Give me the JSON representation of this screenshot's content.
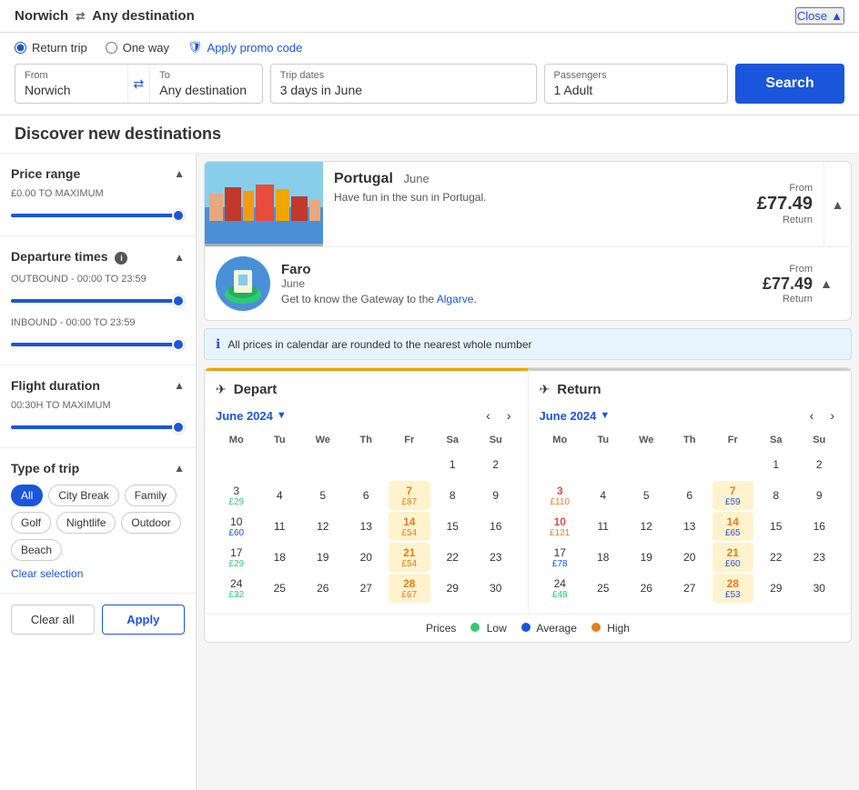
{
  "header": {
    "from": "Norwich",
    "to": "Any destination",
    "close_label": "Close"
  },
  "search_bar": {
    "return_trip_label": "Return trip",
    "one_way_label": "One way",
    "promo_label": "Apply promo code",
    "from_label": "From",
    "from_value": "Norwich",
    "to_label": "To",
    "to_value": "Any destination",
    "trip_dates_label": "Trip dates",
    "trip_dates_value": "3 days in June",
    "passengers_label": "Passengers",
    "passengers_value": "1 Adult",
    "search_button": "Search"
  },
  "discover_banner": "Discover new destinations",
  "filters": {
    "price_range": {
      "title": "Price range",
      "subtitle": "£0.00 TO MAXIMUM"
    },
    "departure_times": {
      "title": "Departure times",
      "outbound_label": "OUTBOUND - 00:00 TO 23:59",
      "inbound_label": "INBOUND - 00:00 TO 23:59"
    },
    "flight_duration": {
      "title": "Flight duration",
      "subtitle": "00:30H TO MAXIMUM"
    },
    "type_of_trip": {
      "title": "Type of trip",
      "tags": [
        "All",
        "City Break",
        "Family",
        "Golf",
        "Nightlife",
        "Outdoor",
        "Beach"
      ],
      "active_tag": "All",
      "clear_selection": "Clear selection"
    },
    "clear_label": "Clear all",
    "apply_label": "Apply"
  },
  "portugal_card": {
    "name": "Portugal",
    "month": "June",
    "desc": "Have fun in the sun in Portugal.",
    "from_label": "From",
    "price": "£77.49",
    "return_label": "Return"
  },
  "faro_card": {
    "name": "Faro",
    "month": "June",
    "desc": "Get to know the Gateway to the Algarve.",
    "from_label": "From",
    "price": "£77.49",
    "return_label": "Return",
    "algarve_word": "Algarve"
  },
  "notice": {
    "text": "All prices in calendar are rounded to the nearest whole number"
  },
  "depart_calendar": {
    "title": "Depart",
    "month": "June 2024",
    "day_headers": [
      "Mo",
      "Tu",
      "We",
      "Th",
      "Fr",
      "Sa",
      "Su"
    ],
    "weeks": [
      [
        null,
        null,
        null,
        null,
        null,
        {
          "num": "1",
          "price": null,
          "type": null
        },
        {
          "num": "2",
          "price": null,
          "type": null
        }
      ],
      [
        {
          "num": "3",
          "price": "£29",
          "type": "low"
        },
        {
          "num": "4",
          "price": null,
          "type": null
        },
        {
          "num": "5",
          "price": null,
          "type": null
        },
        {
          "num": "6",
          "price": null,
          "type": null
        },
        {
          "num": "7",
          "price": "£87",
          "type": "high",
          "highlight": true
        },
        {
          "num": "8",
          "price": null,
          "type": null
        },
        {
          "num": "9",
          "price": null,
          "type": null
        }
      ],
      [
        {
          "num": "10",
          "price": "£60",
          "type": "avg"
        },
        {
          "num": "11",
          "price": null,
          "type": null
        },
        {
          "num": "12",
          "price": null,
          "type": null
        },
        {
          "num": "13",
          "price": null,
          "type": null
        },
        {
          "num": "14",
          "price": "£54",
          "type": "high",
          "highlight": true
        },
        {
          "num": "15",
          "price": null,
          "type": null
        },
        {
          "num": "16",
          "price": null,
          "type": null
        }
      ],
      [
        {
          "num": "17",
          "price": "£29",
          "type": "low"
        },
        {
          "num": "18",
          "price": null,
          "type": null
        },
        {
          "num": "19",
          "price": null,
          "type": null
        },
        {
          "num": "20",
          "price": null,
          "type": null
        },
        {
          "num": "21",
          "price": "£54",
          "type": "high",
          "highlight": true
        },
        {
          "num": "22",
          "price": null,
          "type": null
        },
        {
          "num": "23",
          "price": null,
          "type": null
        }
      ],
      [
        {
          "num": "24",
          "price": "£32",
          "type": "low"
        },
        {
          "num": "25",
          "price": null,
          "type": null
        },
        {
          "num": "26",
          "price": null,
          "type": null
        },
        {
          "num": "27",
          "price": null,
          "type": null
        },
        {
          "num": "28",
          "price": "£67",
          "type": "high",
          "highlight": true
        },
        {
          "num": "29",
          "price": null,
          "type": null
        },
        {
          "num": "30",
          "price": null,
          "type": null
        }
      ]
    ]
  },
  "return_calendar": {
    "title": "Return",
    "month": "June 2024",
    "day_headers": [
      "Mo",
      "Tu",
      "We",
      "Th",
      "Fr",
      "Sa",
      "Su"
    ],
    "weeks": [
      [
        null,
        null,
        null,
        null,
        null,
        {
          "num": "1",
          "price": null,
          "type": null
        },
        {
          "num": "2",
          "price": null,
          "type": null
        }
      ],
      [
        {
          "num": "3",
          "price": "£110",
          "type": "high",
          "red": true
        },
        {
          "num": "4",
          "price": null,
          "type": null
        },
        {
          "num": "5",
          "price": null,
          "type": null
        },
        {
          "num": "6",
          "price": null,
          "type": null
        },
        {
          "num": "7",
          "price": "£59",
          "type": "avg",
          "highlight": true
        },
        {
          "num": "8",
          "price": null,
          "type": null
        },
        {
          "num": "9",
          "price": null,
          "type": null
        }
      ],
      [
        {
          "num": "10",
          "price": "£121",
          "type": "high",
          "red": true
        },
        {
          "num": "11",
          "price": null,
          "type": null
        },
        {
          "num": "12",
          "price": null,
          "type": null
        },
        {
          "num": "13",
          "price": null,
          "type": null
        },
        {
          "num": "14",
          "price": "£65",
          "type": "avg",
          "highlight": true
        },
        {
          "num": "15",
          "price": null,
          "type": null
        },
        {
          "num": "16",
          "price": null,
          "type": null
        }
      ],
      [
        {
          "num": "17",
          "price": "£78",
          "type": "avg"
        },
        {
          "num": "18",
          "price": null,
          "type": null
        },
        {
          "num": "19",
          "price": null,
          "type": null
        },
        {
          "num": "20",
          "price": null,
          "type": null
        },
        {
          "num": "21",
          "price": "£60",
          "type": "avg",
          "highlight": true
        },
        {
          "num": "22",
          "price": null,
          "type": null
        },
        {
          "num": "23",
          "price": null,
          "type": null
        }
      ],
      [
        {
          "num": "24",
          "price": "£48",
          "type": "low"
        },
        {
          "num": "25",
          "price": null,
          "type": null
        },
        {
          "num": "26",
          "price": null,
          "type": null
        },
        {
          "num": "27",
          "price": null,
          "type": null
        },
        {
          "num": "28",
          "price": "£53",
          "type": "avg",
          "highlight": true
        },
        {
          "num": "29",
          "price": null,
          "type": null
        },
        {
          "num": "30",
          "price": null,
          "type": null
        }
      ]
    ]
  },
  "legend": {
    "prices_label": "Prices",
    "low_label": "Low",
    "avg_label": "Average",
    "high_label": "High",
    "low_color": "#2ecc71",
    "avg_color": "#1a56db",
    "high_color": "#e67e22"
  }
}
